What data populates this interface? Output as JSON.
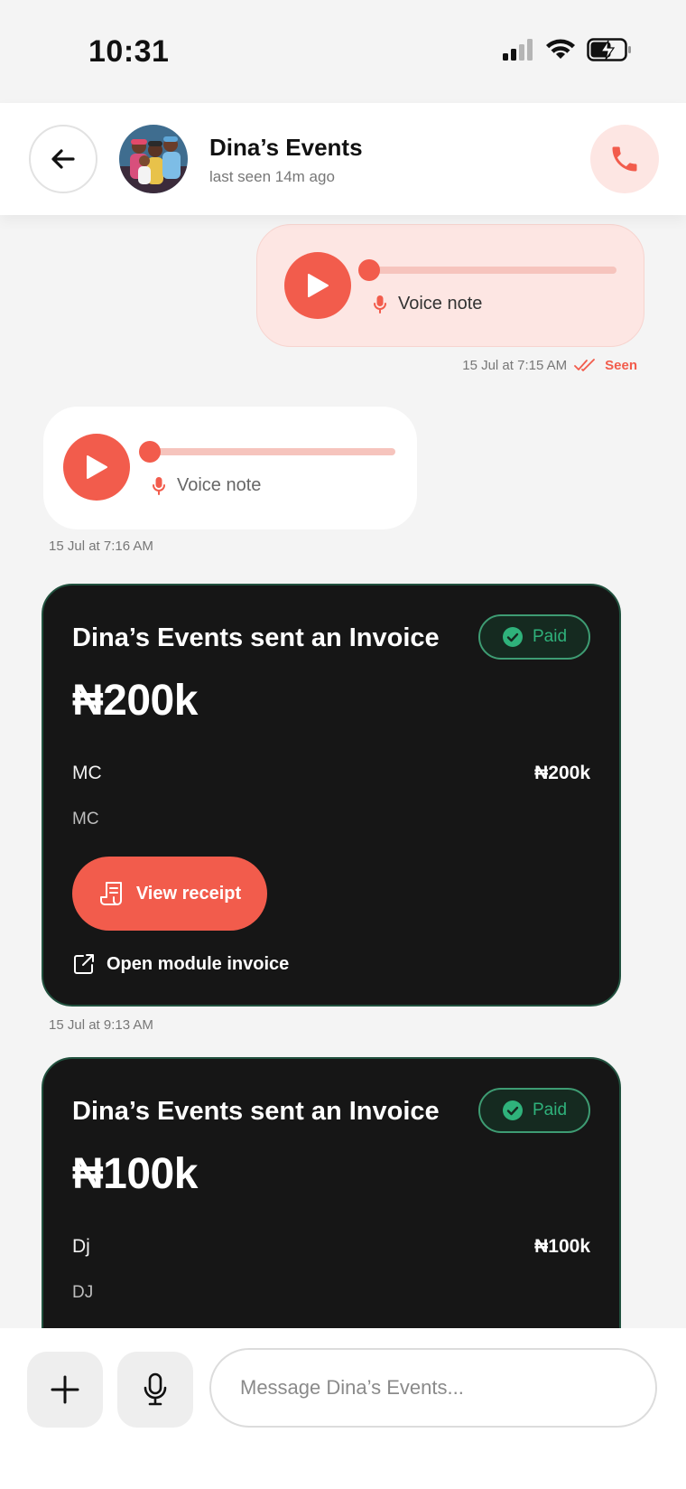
{
  "status_bar": {
    "time": "10:31"
  },
  "header": {
    "contact_name": "Dina’s Events",
    "last_seen": "last seen 14m ago"
  },
  "messages": {
    "outgoing_voice": {
      "label": "Voice note",
      "timestamp": "15 Jul at 7:15 AM",
      "status": "Seen"
    },
    "incoming_voice": {
      "label": "Voice note",
      "timestamp": "15 Jul at 7:16 AM"
    },
    "invoice_1": {
      "title": "Dina’s Events sent an Invoice",
      "badge": "Paid",
      "amount": "₦200k",
      "item_name": "MC",
      "item_price": "₦200k",
      "item_desc": "MC",
      "receipt_label": "View receipt",
      "module_label": "Open module invoice",
      "timestamp": "15 Jul at 9:13 AM"
    },
    "invoice_2": {
      "title": "Dina’s Events sent an Invoice",
      "badge": "Paid",
      "amount": "₦100k",
      "item_name": "Dj",
      "item_price": "₦100k",
      "item_desc": "DJ"
    }
  },
  "composer": {
    "placeholder": "Message Dina’s Events..."
  },
  "icons": {
    "back": "arrow-left-icon",
    "call": "phone-icon",
    "play": "play-icon",
    "mic": "mic-icon",
    "check": "check-circle-icon",
    "receipt": "receipt-icon",
    "external": "external-link-icon",
    "plus": "plus-icon",
    "double_check": "double-check-icon"
  },
  "colors": {
    "accent": "#f25c4c",
    "paid_green": "#2fb27b",
    "card_dark": "#161616"
  }
}
